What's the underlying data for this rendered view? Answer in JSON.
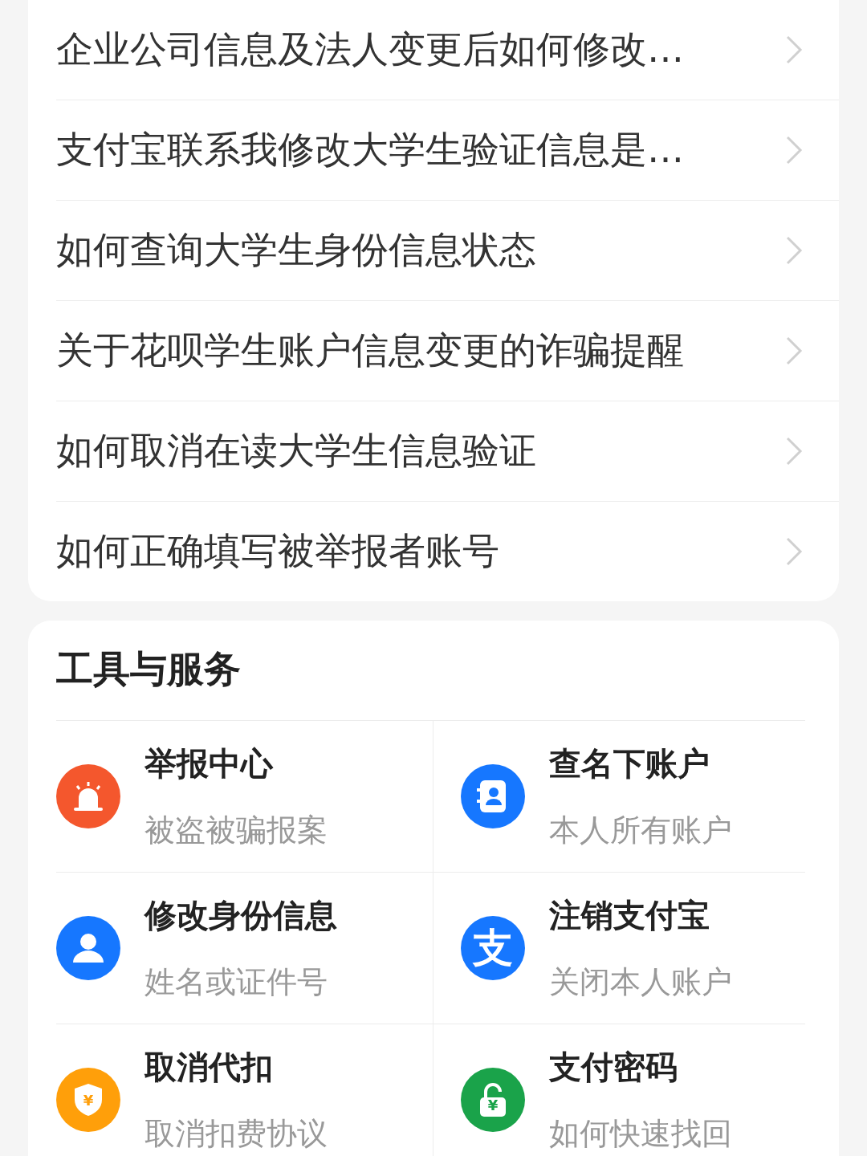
{
  "faq_items": [
    {
      "text": "企业公司信息及法人变更后如何修改…"
    },
    {
      "text": "支付宝联系我修改大学生验证信息是…"
    },
    {
      "text": "如何查询大学生身份信息状态"
    },
    {
      "text": "关于花呗学生账户信息变更的诈骗提醒"
    },
    {
      "text": "如何取消在读大学生信息验证"
    },
    {
      "text": "如何正确填写被举报者账号"
    }
  ],
  "tools": {
    "title": "工具与服务",
    "items": [
      {
        "kind": "siren",
        "color": "#f4572d",
        "title": "举报中心",
        "subtitle": "被盗被骗报案"
      },
      {
        "kind": "card",
        "color": "#1677ff",
        "title": "查名下账户",
        "subtitle": "本人所有账户"
      },
      {
        "kind": "person",
        "color": "#1677ff",
        "title": "修改身份信息",
        "subtitle": "姓名或证件号"
      },
      {
        "kind": "logo",
        "color": "#1677ff",
        "glyph": "支",
        "title": "注销支付宝",
        "subtitle": "关闭本人账户"
      },
      {
        "kind": "shield",
        "color": "#ff9f0a",
        "glyph": "¥",
        "title": "取消代扣",
        "subtitle": "取消扣费协议"
      },
      {
        "kind": "lock",
        "color": "#1aa34a",
        "glyph": "¥",
        "title": "支付密码",
        "subtitle": "如何快速找回"
      }
    ]
  }
}
